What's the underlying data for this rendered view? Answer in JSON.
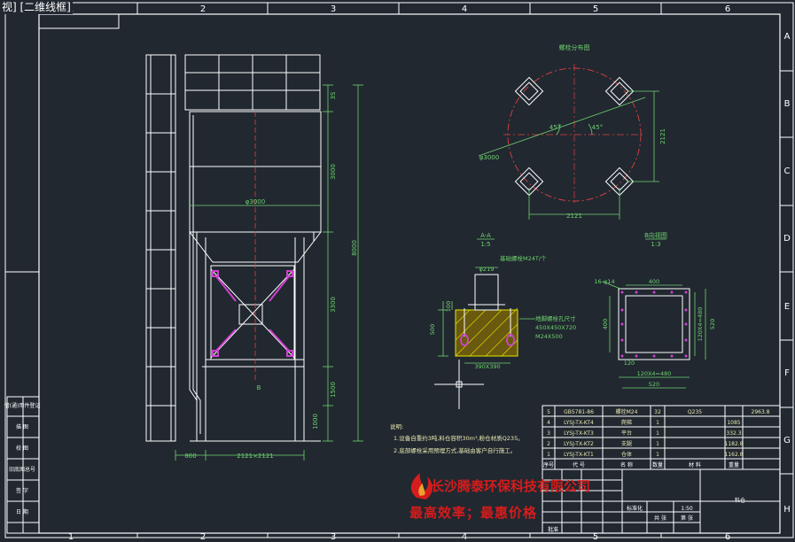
{
  "viewport_label": "视] [二维线框]",
  "colors": {
    "background": "#212830",
    "frame": "#ffffff",
    "line": "#ffffff",
    "dimension": "#6fd26f",
    "center": "#e04040",
    "magenta": "#d040d0",
    "yellow": "#e6e600",
    "table_text": "#e6e6b0",
    "watermark": "#d61c1c"
  },
  "grid_columns": [
    "1",
    "2",
    "3",
    "4",
    "5",
    "6"
  ],
  "grid_rows": [
    "A",
    "B",
    "C",
    "D",
    "E",
    "F",
    "G",
    "H"
  ],
  "left_panel_labels": [
    "借(通)用件登记",
    "描 图",
    "校 图",
    "旧底图总号",
    "签 字",
    "日 期"
  ],
  "elevation": {
    "dims_right": [
      "3S",
      "3000",
      "3300",
      "1500",
      "1000"
    ],
    "dim_overall": "8000",
    "dim_diameter": "φ3000",
    "dim_bottom_left": "860",
    "dim_bottom_span": "2121×2121",
    "dim_small": "B"
  },
  "plan_view": {
    "title": "螺栓分布图",
    "dim_width": "2121",
    "dim_height": "2121",
    "dim_diameter": "φ3000",
    "angle_1": "45°",
    "angle_2": "45°"
  },
  "section_a": {
    "title": "A-A",
    "scale": "1:5",
    "note": "基础螺栓M24T/个",
    "dim_hole": "φ219",
    "dim_left_1": "100",
    "dim_left_2": "500",
    "dim_bottom": "390X390",
    "callout_1": "地脚螺栓孔尺寸",
    "callout_2": "450X450X720",
    "callout_3": "M24X500"
  },
  "section_b": {
    "title": "B向视图",
    "scale": "1:3",
    "dim_top": "400",
    "dim_holes": "16-φ14",
    "dim_left": "400",
    "dim_right_1": "120X4=480",
    "dim_right_2": "520",
    "dim_bottom_1": "120X4=480",
    "dim_bottom_2": "520",
    "dim_small": "120"
  },
  "notes": {
    "title": "说明:",
    "line_1": "1.设备自重约3吨,料仓容积30m³,粉仓材质Q235。",
    "line_2": "2.底部螺栓采用预埋方式,基础由客户自行施工。"
  },
  "bom": {
    "rows": [
      {
        "no": "5",
        "code": "GB5781-86",
        "name": "螺栓M24",
        "qty": "32",
        "mat": "Q235",
        "weight": "1085"
      },
      {
        "no": "4",
        "code": "LYSJ-TX-KT4",
        "name": "爬梯",
        "qty": "1",
        "mat": "",
        "weight": "332.3"
      },
      {
        "no": "3",
        "code": "LYSJ-TX-KT3",
        "name": "平台",
        "qty": "1",
        "mat": "",
        "weight": "1182.8"
      },
      {
        "no": "2",
        "code": "LYSJ-TX-KT2",
        "name": "支腿",
        "qty": "1",
        "mat": "",
        "weight": "1162.8"
      },
      {
        "no": "1",
        "code": "LYSJ-TX-KT1",
        "name": "仓体",
        "qty": "1",
        "mat": "",
        "weight": "2963.8"
      }
    ],
    "header": {
      "no": "序号",
      "code": "代 号",
      "name": "名 称",
      "qty": "数量",
      "mat": "材 料",
      "weight": "重量"
    },
    "title_block_name": "料仓",
    "title_block_cells": [
      "标准化",
      "批准",
      "共 张",
      "第 张",
      "1:50"
    ]
  },
  "watermark": {
    "company": "长沙腾泰环保科技有限公司",
    "slogan": "最高效率；最惠价格"
  }
}
